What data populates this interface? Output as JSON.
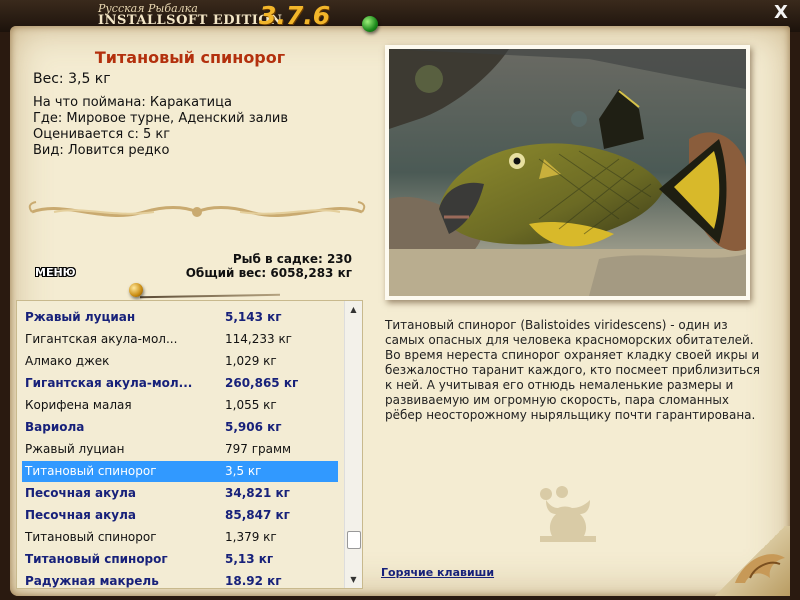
{
  "branding": {
    "title_small": "Русская Рыбалка",
    "title_main": "INSTALLSOFT EDITION",
    "version": "3.7.6",
    "close_glyph": "X"
  },
  "fish": {
    "name": "Титановый спинорог",
    "weight": "Вес: 3,5 кг",
    "caught_with": "На что поймана: Каракатица",
    "location": "Где: Мировое турне, Аденский залив",
    "rated_from": "Оценивается с: 5 кг",
    "rarity": "Вид: Ловится редко"
  },
  "menu_label": "МЕНЮ",
  "stats": {
    "net_count": "Рыб в садке: 230",
    "total_weight": "Общий вес: 6058,283 кг"
  },
  "catch_list": [
    {
      "name": "Ржавый луциан",
      "weight": "5,143 кг",
      "bold": true
    },
    {
      "name": "Гигантская акула-мол...",
      "weight": "114,233 кг",
      "bold": false
    },
    {
      "name": "Алмако джек",
      "weight": "1,029 кг",
      "bold": false
    },
    {
      "name": "Гигантская акула-мол...",
      "weight": "260,865 кг",
      "bold": true
    },
    {
      "name": "Корифена малая",
      "weight": "1,055 кг",
      "bold": false
    },
    {
      "name": "Вариола",
      "weight": "5,906 кг",
      "bold": true
    },
    {
      "name": "Ржавый луциан",
      "weight": "797 грамм",
      "bold": false
    },
    {
      "name": "Титановый спинорог",
      "weight": "3,5 кг",
      "bold": false,
      "selected": true
    },
    {
      "name": "Песочная акула",
      "weight": "34,821 кг",
      "bold": true
    },
    {
      "name": "Песочная акула",
      "weight": "85,847 кг",
      "bold": true
    },
    {
      "name": "Титановый спинорог",
      "weight": "1,379 кг",
      "bold": false
    },
    {
      "name": "Титановый спинорог",
      "weight": "5,13 кг",
      "bold": true
    },
    {
      "name": "Радужная макрель",
      "weight": "18.92 кг",
      "bold": true
    }
  ],
  "description": "Титановый спинорог (Balistoides viridescens) - один из самых опасных для человека красноморских обитателей. Во время нереста спинорог охраняет кладку своей икры и безжалостно таранит каждого, кто посмеет приблизиться к ней. А учитывая его отнюдь немаленькие размеры и развиваемую им огромную скорость, пара сломанных рёбер неосторожному ныряльщику почти гарантирована.",
  "hotkeys_link": "Горячие клавиши",
  "colors": {
    "title_red": "#b3300d",
    "list_bold_blue": "#17217a",
    "selection": "#3199ff",
    "parchment": "#f4ecd2"
  },
  "icons": {
    "close": "close-icon",
    "pin_green": "green-pin-icon",
    "pin_gold": "gold-pin-icon",
    "scroll_up": "chevron-up-icon",
    "scroll_down": "chevron-down-icon"
  }
}
